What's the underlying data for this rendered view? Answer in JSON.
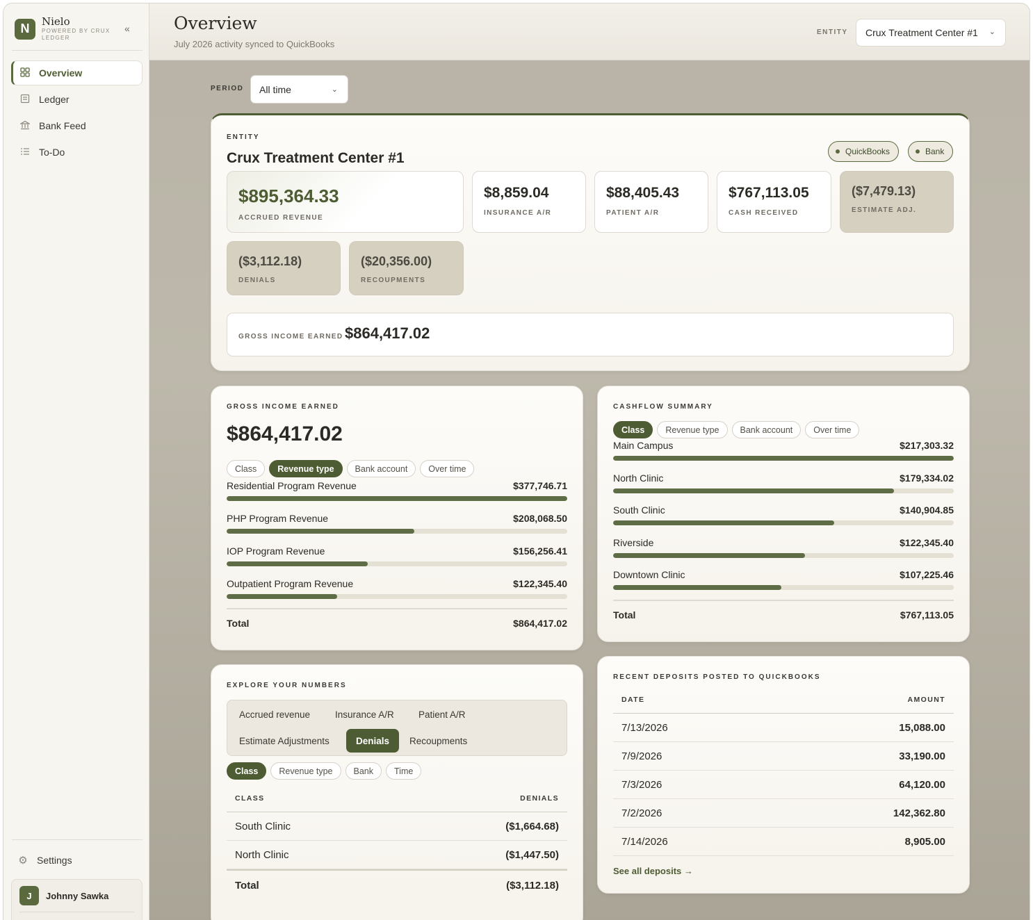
{
  "brand": {
    "name": "Nielo",
    "sub": "POWERED BY CRUX LEDGER",
    "logo": "N"
  },
  "sidebar": {
    "items": [
      {
        "label": "Overview",
        "icon": "grid-icon"
      },
      {
        "label": "Ledger",
        "icon": "ledger-icon"
      },
      {
        "label": "Bank Feed",
        "icon": "bank-icon"
      },
      {
        "label": "To-Do",
        "icon": "list-icon"
      }
    ],
    "settings_label": "Settings",
    "user": {
      "initial": "J",
      "name": "Johnny Sawka"
    }
  },
  "header": {
    "title": "Overview",
    "subtitle": "July 2026 activity synced to QuickBooks",
    "entity_label": "ENTITY",
    "entity_value": "Crux Treatment Center #1"
  },
  "period": {
    "label": "PERIOD",
    "value": "All time"
  },
  "entity_card": {
    "eyebrow": "ENTITY",
    "name": "Crux Treatment Center #1",
    "badges": [
      "QuickBooks",
      "Bank"
    ],
    "metrics": [
      {
        "value": "$895,364.33",
        "label": "ACCRUED REVENUE"
      },
      {
        "value": "$8,859.04",
        "label": "INSURANCE A/R"
      },
      {
        "value": "$88,405.43",
        "label": "PATIENT A/R"
      },
      {
        "value": "$767,113.05",
        "label": "CASH RECEIVED"
      },
      {
        "value": "($7,479.13)",
        "label": "ESTIMATE ADJ."
      },
      {
        "value": "($3,112.18)",
        "label": "DENIALS"
      },
      {
        "value": "($20,356.00)",
        "label": "RECOUPMENTS"
      }
    ],
    "gross_label": "GROSS INCOME EARNED",
    "gross_value": "$864,417.02"
  },
  "gross_income": {
    "eyebrow": "GROSS INCOME EARNED",
    "value": "$864,417.02",
    "tabs": [
      "Class",
      "Revenue type",
      "Bank account",
      "Over time"
    ],
    "active_tab": 1,
    "rows": [
      {
        "name": "Residential Program Revenue",
        "amount": "$377,746.71",
        "share": 1.0
      },
      {
        "name": "PHP Program Revenue",
        "amount": "$208,068.50",
        "share": 0.551
      },
      {
        "name": "IOP Program Revenue",
        "amount": "$156,256.41",
        "share": 0.414
      },
      {
        "name": "Outpatient Program Revenue",
        "amount": "$122,345.40",
        "share": 0.324
      }
    ],
    "total_label": "Total",
    "total_value": "$864,417.02"
  },
  "cashflow": {
    "eyebrow": "CASHFLOW SUMMARY",
    "tabs": [
      "Class",
      "Revenue type",
      "Bank account",
      "Over time"
    ],
    "active_tab": 0,
    "rows": [
      {
        "name": "Main Campus",
        "amount": "$217,303.32",
        "share": 1.0
      },
      {
        "name": "North Clinic",
        "amount": "$179,334.02",
        "share": 0.825
      },
      {
        "name": "South Clinic",
        "amount": "$140,904.85",
        "share": 0.648
      },
      {
        "name": "Riverside",
        "amount": "$122,345.40",
        "share": 0.563
      },
      {
        "name": "Downtown Clinic",
        "amount": "$107,225.46",
        "share": 0.493
      }
    ],
    "total_label": "Total",
    "total_value": "$767,113.05"
  },
  "explore": {
    "eyebrow": "EXPLORE YOUR NUMBERS",
    "metrics_row1": [
      "Accrued revenue",
      "Insurance A/R",
      "Patient A/R"
    ],
    "metrics_row2": [
      "Estimate Adjustments",
      "Denials",
      "Recoupments"
    ],
    "active_metric": "Denials",
    "tabs": [
      "Class",
      "Revenue type",
      "Bank",
      "Time"
    ],
    "active_tab": 0,
    "col_class": "CLASS",
    "col_value": "DENIALS",
    "rows": [
      {
        "name": "South Clinic",
        "amount": "($1,664.68)"
      },
      {
        "name": "North Clinic",
        "amount": "($1,447.50)"
      }
    ],
    "total_label": "Total",
    "total_value": "($3,112.18)"
  },
  "deposits": {
    "eyebrow": "RECENT DEPOSITS POSTED TO QUICKBOOKS",
    "col_date": "DATE",
    "col_amount": "AMOUNT",
    "rows": [
      {
        "date": "7/13/2026",
        "amount": "15,088.00"
      },
      {
        "date": "7/9/2026",
        "amount": "33,190.00"
      },
      {
        "date": "7/3/2026",
        "amount": "64,120.00"
      },
      {
        "date": "7/2/2026",
        "amount": "142,362.80"
      },
      {
        "date": "7/14/2026",
        "amount": "8,905.00"
      }
    ],
    "link": "See all deposits →"
  },
  "colors": {
    "accent": "#4e5c33",
    "bar": "#5e6d45",
    "track": "#e5e0d4",
    "negative_card": "#d6d0c1"
  }
}
